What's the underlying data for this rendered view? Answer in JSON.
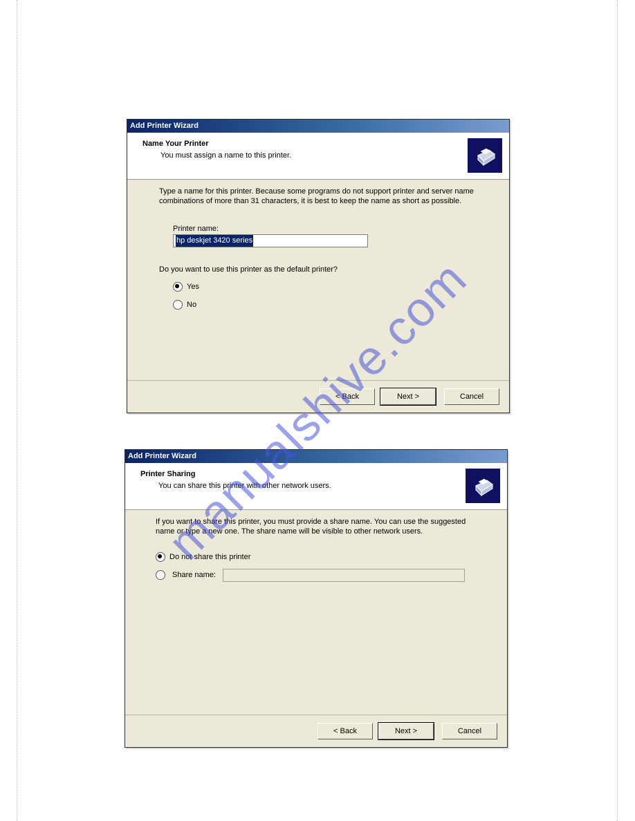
{
  "watermark": "manualshive.com",
  "buttons": {
    "back": "< Back",
    "next": "Next >",
    "cancel": "Cancel"
  },
  "dialog1": {
    "title": "Add Printer Wizard",
    "header": "Name Your Printer",
    "sub": "You must assign a name to this printer.",
    "instruction": "Type a name for this printer. Because some programs do not support printer and server name combinations of more than 31 characters, it is best to keep the name as short as possible.",
    "field_label": "Printer name:",
    "field_value": "hp deskjet 3420 series",
    "question": "Do you want to use this printer as the default printer?",
    "option_yes": "Yes",
    "option_no": "No",
    "default_selected": "Yes"
  },
  "dialog2": {
    "title": "Add Printer Wizard",
    "header": "Printer Sharing",
    "sub": "You can share this printer with other network users.",
    "instruction": "If you want to share this printer, you must provide a share name. You can use the suggested name or type a new one. The share name will be visible to other network users.",
    "option_noshare": "Do not share this printer",
    "option_share": "Share name:",
    "share_value": "",
    "selected": "Do not share this printer"
  }
}
